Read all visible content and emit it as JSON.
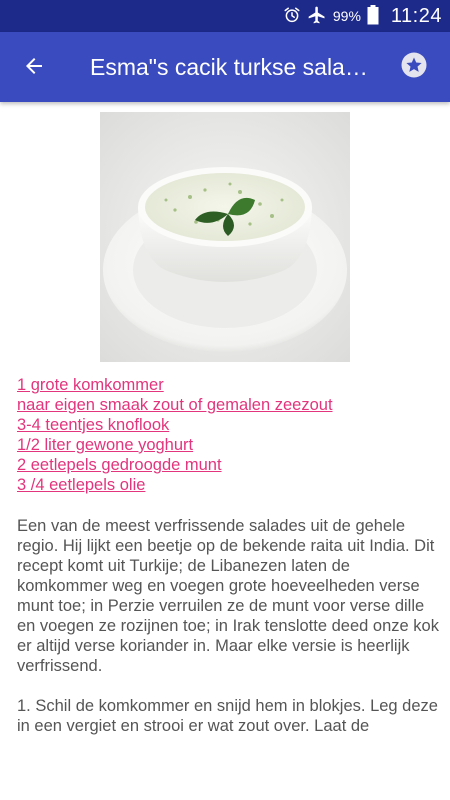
{
  "status_bar": {
    "battery": "99%",
    "time": "11:24"
  },
  "app_bar": {
    "title": "Esma\"s cacik turkse salade recept"
  },
  "recipe": {
    "ingredients": [
      "1 grote komkommer",
      "naar eigen smaak zout of gemalen zeezout",
      "3-4 teentjes knoflook",
      "1/2 liter gewone yoghurt",
      "2 eetlepels gedroogde munt",
      "3 /4 eetlepels olie"
    ],
    "description": "Een van de meest verfrissende salades uit de gehele regio. Hij lijkt een beetje op de bekende raita uit India. Dit recept komt uit Turkije; de Libanezen laten de komkommer weg en voegen grote hoeveelheden verse munt toe; in Perzie verruilen ze de munt voor verse dille en voegen ze rozijnen toe; in Irak tenslotte deed onze kok er altijd verse koriander in. Maar elke versie is heerlijk verfrissend.",
    "steps": "1. Schil de komkommer en snijd hem in blokjes. Leg deze in een vergiet en strooi er wat zout over. Laat de"
  },
  "icons": {
    "back": "arrow-left-icon",
    "favorite": "star-icon",
    "alarm": "alarm-clock-icon",
    "airplane": "airplane-mode-icon",
    "battery": "battery-icon"
  },
  "colors": {
    "status_bar": "#1e2a8a",
    "app_bar": "#3a4bbf",
    "link": "#e2357d",
    "body_text": "#555555"
  }
}
